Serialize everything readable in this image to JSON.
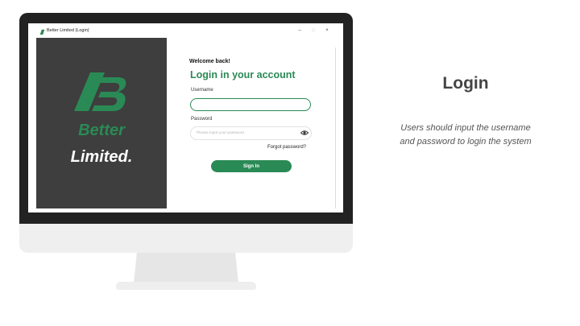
{
  "window": {
    "title": "Better Limited (Login)",
    "minimize_symbol": "–",
    "maximize_symbol": "□",
    "close_symbol": "×"
  },
  "brand": {
    "word1": "Better",
    "word2": "Limited.",
    "primary_color": "#2a8a55",
    "panel_color": "#3e3e3e",
    "logo_icon": "bp-logo-icon"
  },
  "login": {
    "welcome": "Welcome back!",
    "heading": "Login in your account",
    "username_label": "Username",
    "username_value": "",
    "password_label": "Password",
    "password_placeholder": "Please input your password",
    "password_toggle_icon": "eye-icon",
    "forgot_password": "Forgot password?",
    "signin_label": "Sign In"
  },
  "description": {
    "heading": "Login",
    "text": "Users should input the username and password to login the system"
  }
}
